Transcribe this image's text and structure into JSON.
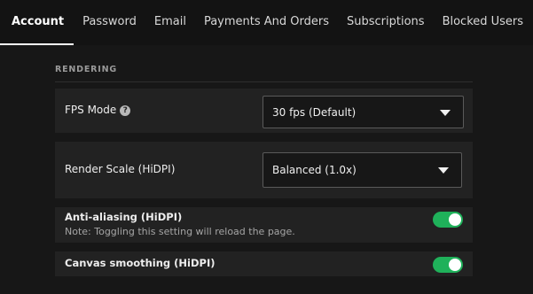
{
  "tabs": [
    {
      "label": "Account",
      "active": true
    },
    {
      "label": "Password"
    },
    {
      "label": "Email"
    },
    {
      "label": "Payments And Orders"
    },
    {
      "label": "Subscriptions"
    },
    {
      "label": "Blocked Users"
    }
  ],
  "section": {
    "title": "RENDERING"
  },
  "fps_mode": {
    "label": "FPS Mode",
    "help_icon": "?",
    "selected": "30 fps (Default)"
  },
  "render_scale": {
    "label": "Render Scale (HiDPI)",
    "selected": "Balanced (1.0x)"
  },
  "anti_aliasing": {
    "label": "Anti-aliasing (HiDPI)",
    "note": "Note: Toggling this setting will reload the page.",
    "enabled": true
  },
  "canvas_smoothing": {
    "label": "Canvas smoothing (HiDPI)",
    "enabled": true
  },
  "colors": {
    "accent": "#1fb15a",
    "background": "#171717",
    "card": "#222222"
  }
}
